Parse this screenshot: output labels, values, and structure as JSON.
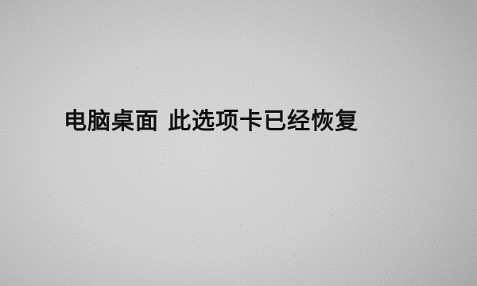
{
  "headline": "电脑桌面 此选项卡已经恢复"
}
